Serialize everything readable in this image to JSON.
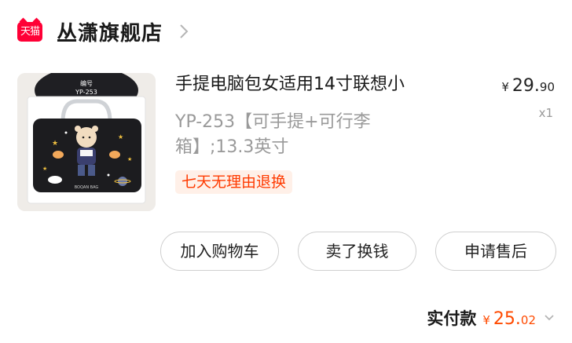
{
  "store": {
    "badge": "天猫",
    "name": "丛潇旗舰店",
    "chevron_icon": "chevron-right-icon"
  },
  "product": {
    "title": "手提电脑包女适用14寸联想小",
    "spec": "YP-253【可手提+可行李箱】;13.3英寸",
    "service_tag": "七天无理由退换",
    "price": {
      "currency": "¥",
      "integer": "29.",
      "decimal": "90"
    },
    "quantity": "x1",
    "image": {
      "label_top": "编号",
      "label_code": "YP-253",
      "brand_text": "BOQAN BAG"
    }
  },
  "actions": {
    "add_to_cart": "加入购物车",
    "resell": "卖了换钱",
    "after_sale": "申请售后"
  },
  "payment": {
    "label": "实付款",
    "currency": "¥",
    "integer": "25.",
    "decimal": "02",
    "chevron_icon": "chevron-down-icon"
  },
  "colors": {
    "tmall_red": "#ff0036",
    "accent_orange": "#ff4a00",
    "tag_bg": "#fff0e8",
    "muted_text": "#9a9a9a"
  }
}
